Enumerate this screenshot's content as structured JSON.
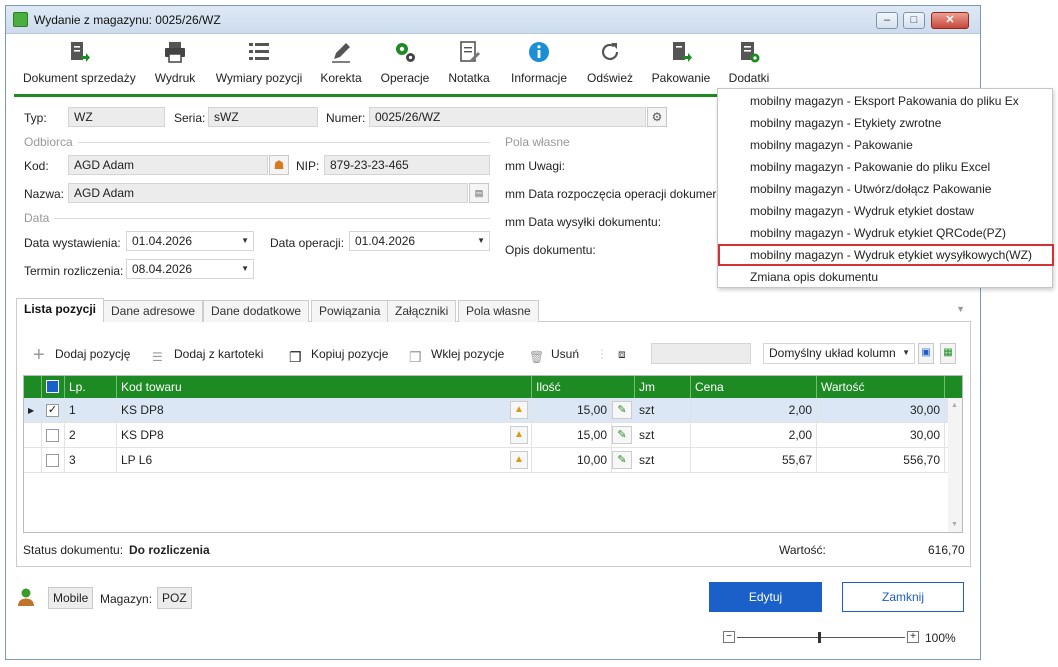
{
  "window": {
    "title": "Wydanie z magazynu: 0025/26/WZ",
    "minimize": "–",
    "maximize": "□",
    "close": "✕"
  },
  "toolbar": [
    {
      "label": "Dokument sprzedaży",
      "icon": "document-arrow-icon"
    },
    {
      "label": "Wydruk",
      "icon": "printer-icon"
    },
    {
      "label": "Wymiary pozycji",
      "icon": "list-icon"
    },
    {
      "label": "Korekta",
      "icon": "pencil-icon"
    },
    {
      "label": "Operacje",
      "icon": "gears-icon"
    },
    {
      "label": "Notatka",
      "icon": "note-icon"
    },
    {
      "label": "Informacje",
      "icon": "info-icon"
    },
    {
      "label": "Odśwież",
      "icon": "refresh-icon"
    },
    {
      "label": "Pakowanie",
      "icon": "package-arrow-icon"
    },
    {
      "label": "Dodatki",
      "icon": "addons-icon"
    }
  ],
  "form": {
    "typ_label": "Typ:",
    "typ": "WZ",
    "seria_label": "Seria:",
    "seria": "sWZ",
    "numer_label": "Numer:",
    "numer": "0025/26/WZ",
    "odbiorca_section": "Odbiorca",
    "kod_label": "Kod:",
    "kod": "AGD Adam",
    "nip_label": "NIP:",
    "nip": "879-23-23-465",
    "nazwa_label": "Nazwa:",
    "nazwa": "AGD Adam",
    "data_section": "Data",
    "data_wyst_label": "Data wystawienia:",
    "data_wyst": "01.04.2026",
    "data_oper_label": "Data operacji:",
    "data_oper": "01.04.2026",
    "termin_label": "Termin rozliczenia:",
    "termin": "08.04.2026",
    "pola_section": "Pola własne",
    "uwagi_label": "mm Uwagi:",
    "rozp_label": "mm Data rozpoczęcia operacji dokumer",
    "wysylki_label": "mm Data wysyłki dokumentu:",
    "opis_label": "Opis dokumentu:"
  },
  "popup": {
    "items": [
      "mobilny magazyn - Eksport Pakowania do pliku Ex",
      "mobilny magazyn - Etykiety zwrotne",
      "mobilny magazyn - Pakowanie",
      "mobilny magazyn - Pakowanie do pliku Excel",
      "mobilny magazyn - Utwórz/dołącz Pakowanie",
      "mobilny magazyn - Wydruk etykiet dostaw",
      "mobilny magazyn - Wydruk etykiet QRCode(PZ)",
      "mobilny magazyn - Wydruk etykiet wysyłkowych(WZ)",
      "Zmiana opis dokumentu"
    ],
    "highlighted_index": 7
  },
  "tabs": [
    "Lista pozycji",
    "Dane adresowe",
    "Dane dodatkowe",
    "Powiązania",
    "Załączniki",
    "Pola własne"
  ],
  "actions": {
    "add": "Dodaj pozycję",
    "add_from": "Dodaj z kartoteki",
    "copy": "Kopiuj pozycje",
    "paste": "Wklej pozycje",
    "delete": "Usuń",
    "layout": "Domyślny układ kolumn"
  },
  "grid": {
    "headers": {
      "lp": "Lp.",
      "kod": "Kod towaru",
      "ilosc": "Ilość",
      "jm": "Jm",
      "cena": "Cena",
      "wartosc": "Wartość"
    },
    "rows": [
      {
        "lp": "1",
        "kod": "KS DP8",
        "ilosc": "15,00",
        "jm": "szt",
        "cena": "2,00",
        "wartosc": "30,00",
        "checked": true
      },
      {
        "lp": "2",
        "kod": "KS DP8",
        "ilosc": "15,00",
        "jm": "szt",
        "cena": "2,00",
        "wartosc": "30,00",
        "checked": false
      },
      {
        "lp": "3",
        "kod": "LP L6",
        "ilosc": "10,00",
        "jm": "szt",
        "cena": "55,67",
        "wartosc": "556,70",
        "checked": false
      }
    ]
  },
  "status": {
    "label": "Status dokumentu:",
    "value": "Do rozliczenia",
    "total_label": "Wartość:",
    "total": "616,70"
  },
  "footer": {
    "mobile": "Mobile",
    "magazyn_label": "Magazyn:",
    "magazyn": "POZ",
    "edit": "Edytuj",
    "close": "Zamknij",
    "zoom": "100%",
    "zoom_minus": "−",
    "zoom_plus": "+"
  },
  "colors": {
    "accent_green": "#1e8a23",
    "primary_blue": "#1b5fc8",
    "highlight_red": "#d33232"
  }
}
